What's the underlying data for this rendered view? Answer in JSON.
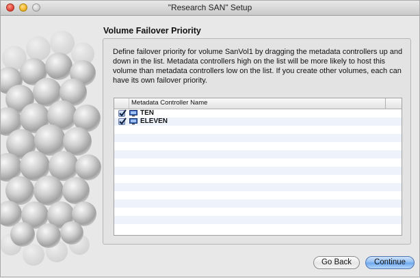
{
  "window": {
    "title": "\"Research SAN\" Setup"
  },
  "page": {
    "heading": "Volume Failover Priority",
    "description": "Define failover priority for volume SanVol1 by dragging the metadata controllers up and down in the list. Metadata controllers high on the list will be more likely to host this volume than metadata controllers low on the list. If you create other volumes, each can have its own failover priority."
  },
  "list": {
    "column_header": "Metadata Controller Name",
    "rows": [
      {
        "label": "TEN",
        "checked": true,
        "icon": "computer-monitor-icon"
      },
      {
        "label": "ELEVEN",
        "checked": true,
        "icon": "computer-monitor-icon"
      }
    ]
  },
  "buttons": {
    "back": "Go Back",
    "continue": "Continue"
  },
  "colors": {
    "accent": "#6aa6ee",
    "row_alt": "#eef3fb"
  }
}
